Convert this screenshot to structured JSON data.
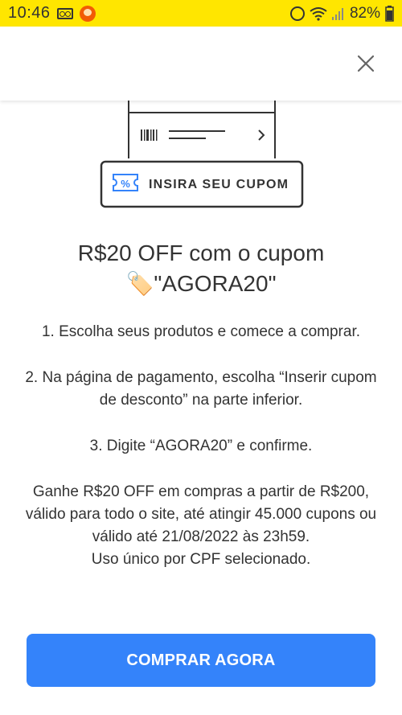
{
  "status_bar": {
    "time": "10:46",
    "battery": "82%"
  },
  "illustration": {
    "coupon_label": "INSIRA SEU CUPOM"
  },
  "content": {
    "title_line1": "R$20 OFF com o cupom",
    "tag_emoji": "🏷️",
    "title_line2": "\"AGORA20\"",
    "step1": "1. Escolha seus produtos e comece a comprar.",
    "step2": "2. Na página de pagamento, escolha “Inserir cupom de desconto” na parte inferior.",
    "step3": "3. Digite “AGORA20” e confirme.",
    "terms": "Ganhe R$20 OFF em compras a partir de R$200, válido para todo o site, até atingir 45.000 cupons ou válido até 21/08/2022 às 23h59.",
    "terms_usage": "Uso único por CPF selecionado."
  },
  "cta": {
    "label": "COMPRAR AGORA"
  },
  "colors": {
    "status_bar": "#ffe600",
    "primary": "#3483fa",
    "text": "#333333"
  }
}
